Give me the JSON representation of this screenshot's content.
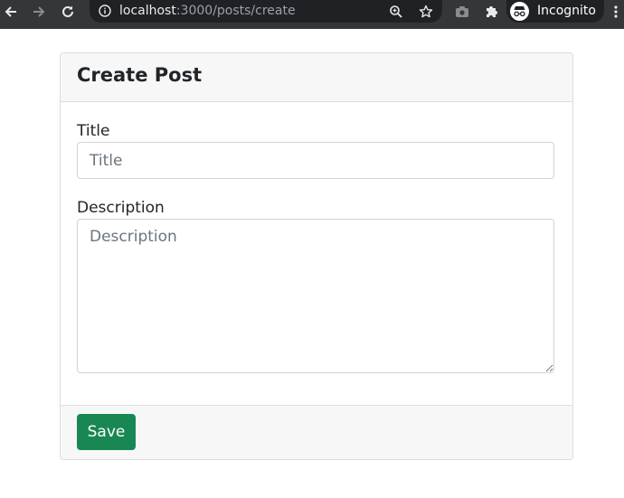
{
  "browser": {
    "url_host": "localhost",
    "url_path": ":3000/posts/create",
    "profile_label": "Incognito",
    "icons": {
      "back": "back-arrow-icon",
      "forward": "forward-arrow-icon",
      "reload": "reload-icon",
      "site_info": "info-icon",
      "zoom": "zoom-icon",
      "bookmark": "star-icon",
      "camera": "camera-icon",
      "extensions": "puzzle-icon",
      "profile": "incognito-icon",
      "menu": "kebab-menu-icon"
    }
  },
  "card": {
    "title": "Create Post",
    "fields": {
      "title": {
        "label": "Title",
        "value": "",
        "placeholder": "Title"
      },
      "description": {
        "label": "Description",
        "value": "",
        "placeholder": "Description"
      }
    },
    "save_label": "Save"
  },
  "colors": {
    "chrome_bg": "#35363a",
    "omnibox_bg": "#202124",
    "primary_button": "#198754",
    "card_header_bg": "#f7f7f7"
  }
}
